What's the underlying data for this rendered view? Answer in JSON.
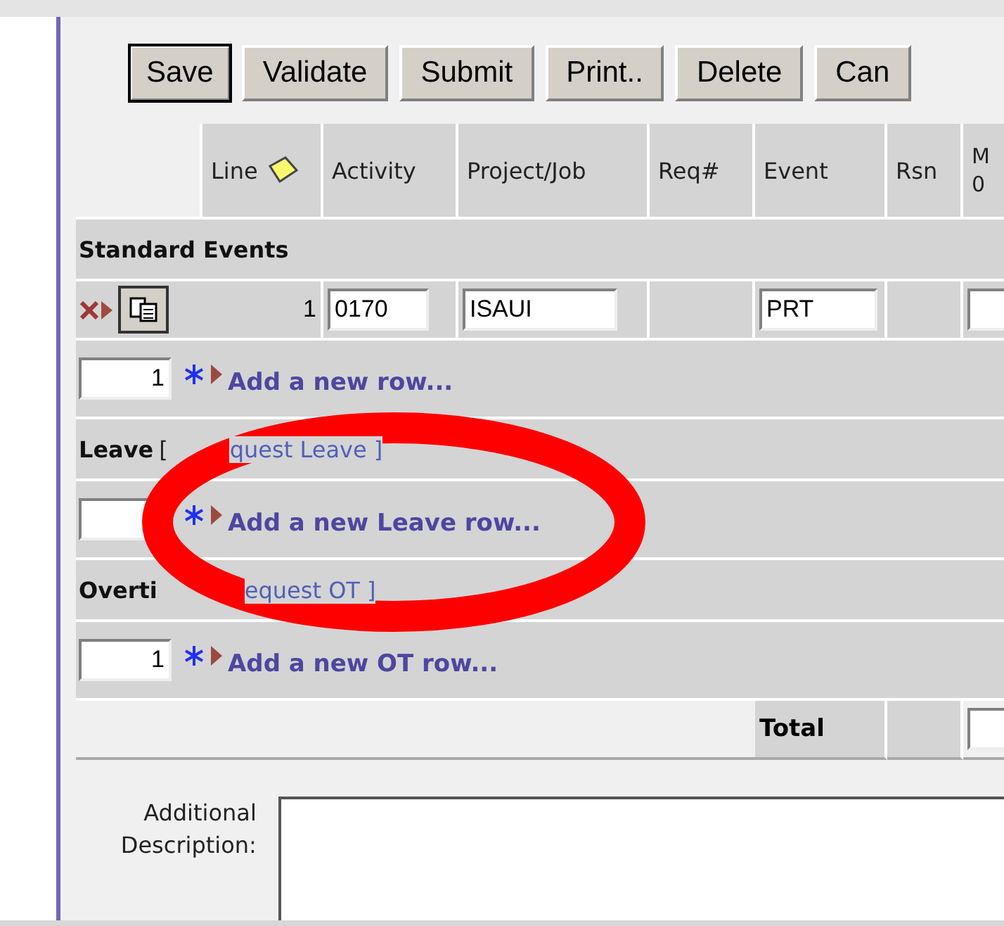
{
  "toolbar": {
    "buttons": [
      {
        "label": "Save",
        "default": true
      },
      {
        "label": "Validate",
        "default": false
      },
      {
        "label": "Submit",
        "default": false
      },
      {
        "label": "Print..",
        "default": false
      },
      {
        "label": "Delete",
        "default": false
      },
      {
        "label": "Can",
        "default": false
      }
    ]
  },
  "table": {
    "columns": [
      {
        "label": "Line"
      },
      {
        "label": "Activity"
      },
      {
        "label": "Project/Job"
      },
      {
        "label": "Req#"
      },
      {
        "label": "Event"
      },
      {
        "label": "Rsn"
      },
      {
        "label": "M 0"
      }
    ],
    "sections": [
      {
        "kind": "standard",
        "title": "Standard Events",
        "rows": [
          {
            "line": "1",
            "activity": "0170",
            "project": "ISAUI",
            "event": "PRT"
          }
        ],
        "add_count": "1",
        "add_link": "Add a new row..."
      },
      {
        "kind": "leave",
        "title": "Leave",
        "bracket": "[",
        "link": "quest Leave ]",
        "add_link": "Add a new Leave row..."
      },
      {
        "kind": "overtime",
        "title": "Overti",
        "link": "equest OT ]",
        "add_count": "1",
        "add_link": "Add a new OT row..."
      }
    ],
    "total": {
      "label": "Total"
    }
  },
  "description": {
    "label": "Additional Description:"
  },
  "annotation": {
    "kind": "ellipse"
  }
}
